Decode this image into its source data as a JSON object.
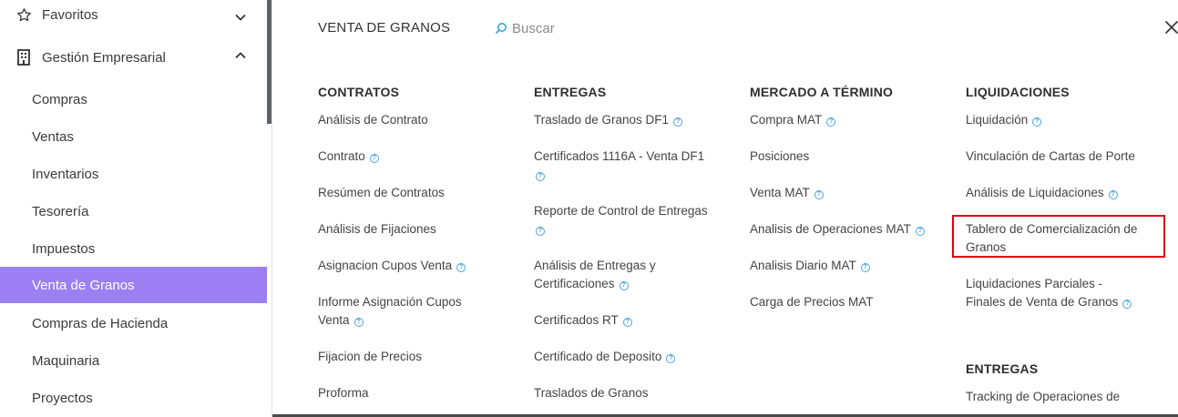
{
  "sidebar": {
    "favorites": {
      "label": "Favoritos"
    },
    "group": {
      "label": "Gestión Empresarial"
    },
    "items": [
      {
        "label": "Compras"
      },
      {
        "label": "Ventas"
      },
      {
        "label": "Inventarios"
      },
      {
        "label": "Tesorería"
      },
      {
        "label": "Impuestos"
      },
      {
        "label": "Venta de Granos"
      },
      {
        "label": "Compras de Hacienda"
      },
      {
        "label": "Maquinaria"
      },
      {
        "label": "Proyectos"
      }
    ],
    "active_color": "#9b7ff3"
  },
  "panel": {
    "title": "VENTA DE GRANOS",
    "search_placeholder": "Buscar",
    "help_glyph": "?"
  },
  "columns": [
    {
      "heading": "CONTRATOS",
      "links": [
        "Análisis de Contrato",
        "Contrato",
        "Resúmen de Contratos",
        "Análisis de Fijaciones",
        "Asignacion Cupos Venta",
        "Informe Asignación Cupos",
        "Venta",
        "Fijacion de Precios",
        "Proforma"
      ]
    },
    {
      "heading": "ENTREGAS",
      "links": [
        "Traslado de Granos DF1",
        "Certificados 1116A - Venta DF1",
        "Reporte de Control de Entregas",
        "Análisis de Entregas y",
        "Certificaciones",
        "Certificados RT",
        "Certificado de Deposito",
        "Traslados de Granos"
      ]
    },
    {
      "heading": "MERCADO A TÉRMINO",
      "links": [
        "Compra MAT",
        "Posiciones",
        "Venta MAT",
        "Analisis de Operaciones MAT",
        "Analisis Diario MAT",
        "Carga de Precios MAT"
      ]
    },
    {
      "heading": "LIQUIDACIONES",
      "links": [
        "Liquidación",
        "Vinculación de Cartas de Porte",
        "Análisis de Liquidaciones",
        "Tablero de Comercialización de",
        "Granos",
        "Liquidaciones Parciales -",
        "Finales de Venta de Granos"
      ]
    },
    {
      "heading": "ENTREGAS",
      "links": [
        "Tracking de Operaciones de"
      ]
    }
  ]
}
